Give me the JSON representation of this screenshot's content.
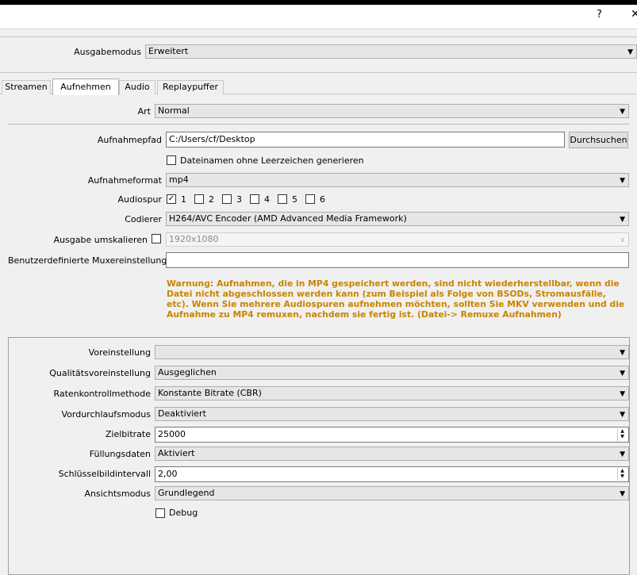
{
  "titlebar": {
    "help_glyph": "?",
    "close_glyph": "✕"
  },
  "output_mode": {
    "label": "Ausgabemodus",
    "value": "Erweitert"
  },
  "tabs": [
    {
      "label": "Streamen"
    },
    {
      "label": "Aufnehmen"
    },
    {
      "label": "Audio"
    },
    {
      "label": "Replaypuffer"
    }
  ],
  "recording": {
    "type": {
      "label": "Art",
      "value": "Normal"
    },
    "path": {
      "label": "Aufnahmepfad",
      "value": "C:/Users/cf/Desktop",
      "browse_label": "Durchsuchen"
    },
    "no_spaces": {
      "label": "Dateinamen ohne Leerzeichen generieren",
      "checked": false
    },
    "format": {
      "label": "Aufnahmeformat",
      "value": "mp4"
    },
    "audio_track": {
      "label": "Audiospur",
      "tracks": [
        "1",
        "2",
        "3",
        "4",
        "5",
        "6"
      ],
      "checked_track": "1"
    },
    "encoder": {
      "label": "Codierer",
      "value": "H264/AVC Encoder (AMD Advanced Media Framework)"
    },
    "rescale": {
      "label": "Ausgabe umskalieren",
      "value": "1920x1080",
      "checked": false
    },
    "muxer": {
      "label": "Benutzerdefinierte Muxereinstellungen",
      "value": ""
    },
    "warning": "Warnung: Aufnahmen, die in MP4 gespeichert werden, sind nicht wiederherstellbar, wenn die Datei nicht abgeschlossen werden kann (zum Beispiel als Folge von BSODs, Stromausfälle, etc). Wenn Sie mehrere Audiospuren aufnehmen möchten, sollten Sie MKV verwenden und die Aufnahme zu MP4 remuxen, nachdem sie fertig ist. (Datei-> Remuxe Aufnahmen)"
  },
  "encoder_settings": {
    "preset": {
      "label": "Voreinstellung",
      "value": ""
    },
    "quality_preset": {
      "label": "Qualitätsvoreinstellung",
      "value": "Ausgeglichen"
    },
    "rate_control": {
      "label": "Ratenkontrollmethode",
      "value": "Konstante Bitrate (CBR)"
    },
    "prepass": {
      "label": "Vordurchlaufsmodus",
      "value": "Deaktiviert"
    },
    "target_bitrate": {
      "label": "Zielbitrate",
      "value": "25000"
    },
    "filler_data": {
      "label": "Füllungsdaten",
      "value": "Aktiviert"
    },
    "keyframe_interval": {
      "label": "Schlüsselbildintervall",
      "value": "2,00"
    },
    "view_mode": {
      "label": "Ansichtsmodus",
      "value": "Grundlegend"
    },
    "debug": {
      "label": "Debug",
      "checked": false
    }
  }
}
